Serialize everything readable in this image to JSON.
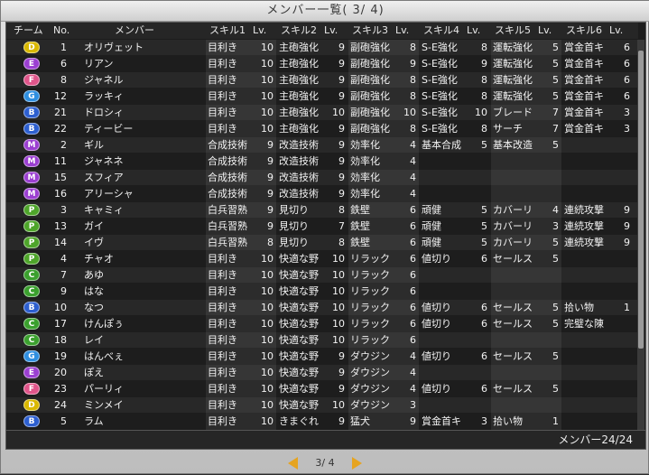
{
  "title": "メンバー一覧( 3/ 4)",
  "headers": {
    "team": "チーム",
    "no": "No.",
    "name": "メンバー",
    "s1": "スキル1",
    "s2": "スキル2",
    "s3": "スキル3",
    "s4": "スキル4",
    "s5": "スキル5",
    "s6": "スキル6",
    "lv": "Lv."
  },
  "badge_colors": {
    "D": "#d9b800",
    "E": "#9b3fd1",
    "F": "#e0558a",
    "G": "#2f8fe0",
    "B": "#2d5fd0",
    "M": "#9b3fd1",
    "P": "#4ea52a",
    "C": "#3ba02e"
  },
  "rows": [
    {
      "team": "D",
      "no": "1",
      "name": "オリヴェット",
      "s1": "目利き",
      "l1": "10",
      "s2": "主砲強化",
      "l2": "9",
      "s3": "副砲強化",
      "l3": "8",
      "s4": "S-E強化",
      "l4": "8",
      "s5": "運転強化",
      "l5": "5",
      "s6": "賞金首キ",
      "l6": "6"
    },
    {
      "team": "E",
      "no": "6",
      "name": "リアン",
      "s1": "目利き",
      "l1": "10",
      "s2": "主砲強化",
      "l2": "9",
      "s3": "副砲強化",
      "l3": "9",
      "s4": "S-E強化",
      "l4": "9",
      "s5": "運転強化",
      "l5": "5",
      "s6": "賞金首キ",
      "l6": "6"
    },
    {
      "team": "F",
      "no": "8",
      "name": "ジャネル",
      "s1": "目利き",
      "l1": "10",
      "s2": "主砲強化",
      "l2": "9",
      "s3": "副砲強化",
      "l3": "8",
      "s4": "S-E強化",
      "l4": "8",
      "s5": "運転強化",
      "l5": "5",
      "s6": "賞金首キ",
      "l6": "6"
    },
    {
      "team": "G",
      "no": "12",
      "name": "ラッキィ",
      "s1": "目利き",
      "l1": "10",
      "s2": "主砲強化",
      "l2": "9",
      "s3": "副砲強化",
      "l3": "8",
      "s4": "S-E強化",
      "l4": "8",
      "s5": "運転強化",
      "l5": "5",
      "s6": "賞金首キ",
      "l6": "6"
    },
    {
      "team": "B",
      "no": "21",
      "name": "ドロシィ",
      "s1": "目利き",
      "l1": "10",
      "s2": "主砲強化",
      "l2": "10",
      "s3": "副砲強化",
      "l3": "10",
      "s4": "S-E強化",
      "l4": "10",
      "s5": "ブレード",
      "l5": "7",
      "s6": "賞金首キ",
      "l6": "3"
    },
    {
      "team": "B",
      "no": "22",
      "name": "ティービー",
      "s1": "目利き",
      "l1": "10",
      "s2": "主砲強化",
      "l2": "9",
      "s3": "副砲強化",
      "l3": "8",
      "s4": "S-E強化",
      "l4": "8",
      "s5": "サーチ",
      "l5": "7",
      "s6": "賞金首キ",
      "l6": "3"
    },
    {
      "team": "M",
      "no": "2",
      "name": "ギル",
      "s1": "合成技術",
      "l1": "9",
      "s2": "改造技術",
      "l2": "9",
      "s3": "効率化",
      "l3": "4",
      "s4": "基本合成",
      "l4": "5",
      "s5": "基本改造",
      "l5": "5",
      "s6": "",
      "l6": ""
    },
    {
      "team": "M",
      "no": "11",
      "name": "ジャネネ",
      "s1": "合成技術",
      "l1": "9",
      "s2": "改造技術",
      "l2": "9",
      "s3": "効率化",
      "l3": "4",
      "s4": "",
      "l4": "",
      "s5": "",
      "l5": "",
      "s6": "",
      "l6": ""
    },
    {
      "team": "M",
      "no": "15",
      "name": "スフィア",
      "s1": "合成技術",
      "l1": "9",
      "s2": "改造技術",
      "l2": "9",
      "s3": "効率化",
      "l3": "4",
      "s4": "",
      "l4": "",
      "s5": "",
      "l5": "",
      "s6": "",
      "l6": ""
    },
    {
      "team": "M",
      "no": "16",
      "name": "アリーシャ",
      "s1": "合成技術",
      "l1": "9",
      "s2": "改造技術",
      "l2": "9",
      "s3": "効率化",
      "l3": "4",
      "s4": "",
      "l4": "",
      "s5": "",
      "l5": "",
      "s6": "",
      "l6": ""
    },
    {
      "team": "P",
      "no": "3",
      "name": "キャミィ",
      "s1": "白兵習熟",
      "l1": "9",
      "s2": "見切り",
      "l2": "8",
      "s3": "鉄壁",
      "l3": "6",
      "s4": "頑健",
      "l4": "5",
      "s5": "カバーリ",
      "l5": "4",
      "s6": "連続攻撃",
      "l6": "9"
    },
    {
      "team": "P",
      "no": "13",
      "name": "ガイ",
      "s1": "白兵習熟",
      "l1": "9",
      "s2": "見切り",
      "l2": "7",
      "s3": "鉄壁",
      "l3": "6",
      "s4": "頑健",
      "l4": "5",
      "s5": "カバーリ",
      "l5": "3",
      "s6": "連続攻撃",
      "l6": "9"
    },
    {
      "team": "P",
      "no": "14",
      "name": "イヴ",
      "s1": "白兵習熟",
      "l1": "8",
      "s2": "見切り",
      "l2": "8",
      "s3": "鉄壁",
      "l3": "6",
      "s4": "頑健",
      "l4": "5",
      "s5": "カバーリ",
      "l5": "5",
      "s6": "連続攻撃",
      "l6": "9"
    },
    {
      "team": "P",
      "no": "4",
      "name": "チャオ",
      "s1": "目利き",
      "l1": "10",
      "s2": "快適な野",
      "l2": "10",
      "s3": "リラック",
      "l3": "6",
      "s4": "値切り",
      "l4": "6",
      "s5": "セールス",
      "l5": "5",
      "s6": "",
      "l6": ""
    },
    {
      "team": "C",
      "no": "7",
      "name": "あゆ",
      "s1": "目利き",
      "l1": "10",
      "s2": "快適な野",
      "l2": "10",
      "s3": "リラック",
      "l3": "6",
      "s4": "",
      "l4": "",
      "s5": "",
      "l5": "",
      "s6": "",
      "l6": ""
    },
    {
      "team": "C",
      "no": "9",
      "name": "はな",
      "s1": "目利き",
      "l1": "10",
      "s2": "快適な野",
      "l2": "10",
      "s3": "リラック",
      "l3": "6",
      "s4": "",
      "l4": "",
      "s5": "",
      "l5": "",
      "s6": "",
      "l6": ""
    },
    {
      "team": "B",
      "no": "10",
      "name": "なつ",
      "s1": "目利き",
      "l1": "10",
      "s2": "快適な野",
      "l2": "10",
      "s3": "リラック",
      "l3": "6",
      "s4": "値切り",
      "l4": "6",
      "s5": "セールス",
      "l5": "5",
      "s6": "拾い物",
      "l6": "1"
    },
    {
      "team": "C",
      "no": "17",
      "name": "けんぽぅ",
      "s1": "目利き",
      "l1": "10",
      "s2": "快適な野",
      "l2": "10",
      "s3": "リラック",
      "l3": "6",
      "s4": "値切り",
      "l4": "6",
      "s5": "セールス",
      "l5": "5",
      "s6": "完璧な陳",
      "l6": ""
    },
    {
      "team": "C",
      "no": "18",
      "name": "レイ",
      "s1": "目利き",
      "l1": "10",
      "s2": "快適な野",
      "l2": "10",
      "s3": "リラック",
      "l3": "6",
      "s4": "",
      "l4": "",
      "s5": "",
      "l5": "",
      "s6": "",
      "l6": ""
    },
    {
      "team": "G",
      "no": "19",
      "name": "はんべぇ",
      "s1": "目利き",
      "l1": "10",
      "s2": "快適な野",
      "l2": "9",
      "s3": "ダウジン",
      "l3": "4",
      "s4": "値切り",
      "l4": "6",
      "s5": "セールス",
      "l5": "5",
      "s6": "",
      "l6": ""
    },
    {
      "team": "E",
      "no": "20",
      "name": "ぽえ",
      "s1": "目利き",
      "l1": "10",
      "s2": "快適な野",
      "l2": "9",
      "s3": "ダウジン",
      "l3": "4",
      "s4": "",
      "l4": "",
      "s5": "",
      "l5": "",
      "s6": "",
      "l6": ""
    },
    {
      "team": "F",
      "no": "23",
      "name": "パーリィ",
      "s1": "目利き",
      "l1": "10",
      "s2": "快適な野",
      "l2": "9",
      "s3": "ダウジン",
      "l3": "4",
      "s4": "値切り",
      "l4": "6",
      "s5": "セールス",
      "l5": "5",
      "s6": "",
      "l6": ""
    },
    {
      "team": "D",
      "no": "24",
      "name": "ミンメイ",
      "s1": "目利き",
      "l1": "10",
      "s2": "快適な野",
      "l2": "10",
      "s3": "ダウジン",
      "l3": "3",
      "s4": "",
      "l4": "",
      "s5": "",
      "l5": "",
      "s6": "",
      "l6": ""
    },
    {
      "team": "B",
      "no": "5",
      "name": "ラム",
      "s1": "目利き",
      "l1": "10",
      "s2": "きまぐれ",
      "l2": "9",
      "s3": "猛犬",
      "l3": "9",
      "s4": "賞金首キ",
      "l4": "3",
      "s5": "拾い物",
      "l5": "1",
      "s6": "",
      "l6": ""
    }
  ],
  "member_count": "メンバー24/24",
  "page_label": "3/ 4"
}
